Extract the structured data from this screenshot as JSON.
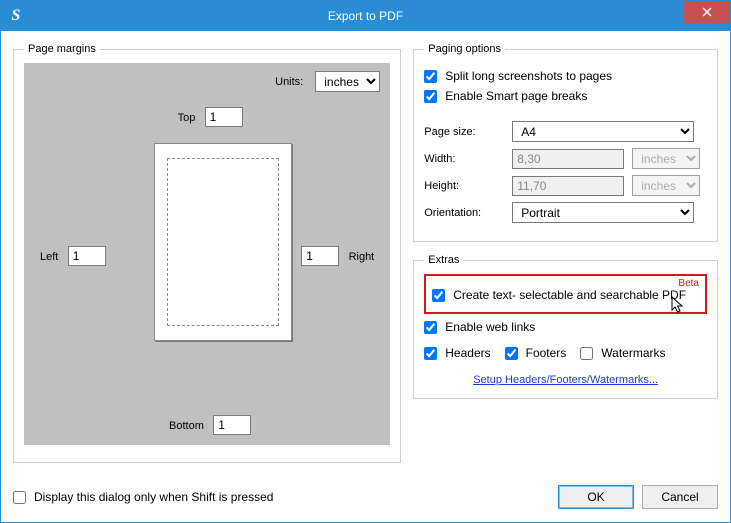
{
  "window": {
    "title": "Export to PDF",
    "app_initial": "S"
  },
  "page_margins": {
    "legend": "Page margins",
    "units_label": "Units:",
    "units_value": "inches",
    "top_label": "Top",
    "top_value": "1",
    "bottom_label": "Bottom",
    "bottom_value": "1",
    "left_label": "Left",
    "left_value": "1",
    "right_label": "Right",
    "right_value": "1"
  },
  "paging": {
    "legend": "Paging options",
    "split_label": "Split long screenshots to pages",
    "smart_label": "Enable Smart page breaks",
    "page_size_label": "Page size:",
    "page_size_value": "A4",
    "width_label": "Width:",
    "width_value": "8,30",
    "width_unit": "inches",
    "height_label": "Height:",
    "height_value": "11,70",
    "height_unit": "inches",
    "orientation_label": "Orientation:",
    "orientation_value": "Portrait"
  },
  "extras": {
    "legend": "Extras",
    "searchable_label": "Create text- selectable and searchable PDF",
    "beta_label": "Beta",
    "weblinks_label": "Enable web links",
    "headers_label": "Headers",
    "footers_label": "Footers",
    "watermarks_label": "Watermarks",
    "setup_link": "Setup Headers/Footers/Watermarks..."
  },
  "footer": {
    "display_shift_label": "Display this dialog only when Shift is pressed",
    "ok_label": "OK",
    "cancel_label": "Cancel"
  }
}
